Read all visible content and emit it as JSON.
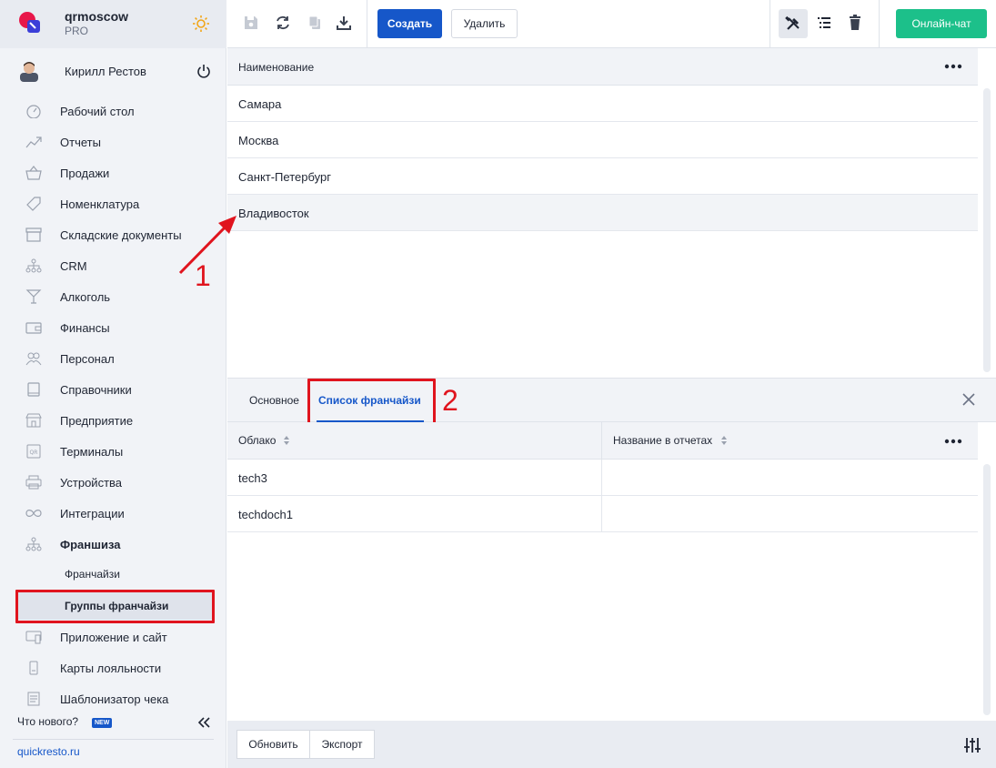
{
  "brand": {
    "name": "qrmoscow",
    "plan": "PRO"
  },
  "user": {
    "name": "Кирилл Рестов"
  },
  "sidebar": {
    "items": [
      {
        "label": "Рабочий стол",
        "icon": "dashboard-icon"
      },
      {
        "label": "Отчеты",
        "icon": "chart-icon"
      },
      {
        "label": "Продажи",
        "icon": "basket-icon"
      },
      {
        "label": "Номенклатура",
        "icon": "tag-icon"
      },
      {
        "label": "Складские документы",
        "icon": "archive-icon"
      },
      {
        "label": "CRM",
        "icon": "hierarchy-icon"
      },
      {
        "label": "Алкоголь",
        "icon": "cocktail-icon"
      },
      {
        "label": "Финансы",
        "icon": "wallet-icon"
      },
      {
        "label": "Персонал",
        "icon": "people-icon"
      },
      {
        "label": "Справочники",
        "icon": "book-icon"
      },
      {
        "label": "Предприятие",
        "icon": "store-icon"
      },
      {
        "label": "Терминалы",
        "icon": "qr-icon"
      },
      {
        "label": "Устройства",
        "icon": "printer-icon"
      },
      {
        "label": "Интеграции",
        "icon": "infinity-icon"
      },
      {
        "label": "Франшиза",
        "icon": "hierarchy-icon"
      }
    ],
    "franchise_sub": [
      {
        "label": "Франчайзи"
      },
      {
        "label": "Группы франчайзи"
      }
    ],
    "items_after": [
      {
        "label": "Приложение и сайт",
        "icon": "app-icon"
      },
      {
        "label": "Карты лояльности",
        "icon": "card-icon"
      },
      {
        "label": "Шаблонизатор чека",
        "icon": "receipt-icon"
      }
    ],
    "whats_new": "Что нового?",
    "new_badge": "NEW",
    "site_link": "quickresto.ru"
  },
  "toolbar": {
    "create_label": "Создать",
    "delete_label": "Удалить",
    "chat_label": "Онлайн-чат"
  },
  "top_grid": {
    "header": "Наименование",
    "rows": [
      "Самара",
      "Москва",
      "Санкт-Петербург",
      "Владивосток"
    ]
  },
  "tabs": {
    "items": [
      "Основное",
      "Список франчайзи"
    ],
    "active": "Список франчайзи"
  },
  "bottom_grid": {
    "columns": [
      "Облако",
      "Название в отчетах"
    ],
    "rows": [
      [
        "tech3",
        ""
      ],
      [
        "techdoch1",
        ""
      ]
    ]
  },
  "footer": {
    "refresh_label": "Обновить",
    "export_label": "Экспорт"
  },
  "annotations": {
    "one": "1",
    "two": "2"
  },
  "colors": {
    "accent": "#1657c9",
    "chat": "#1cc08a",
    "highlight": "#e0141e"
  }
}
